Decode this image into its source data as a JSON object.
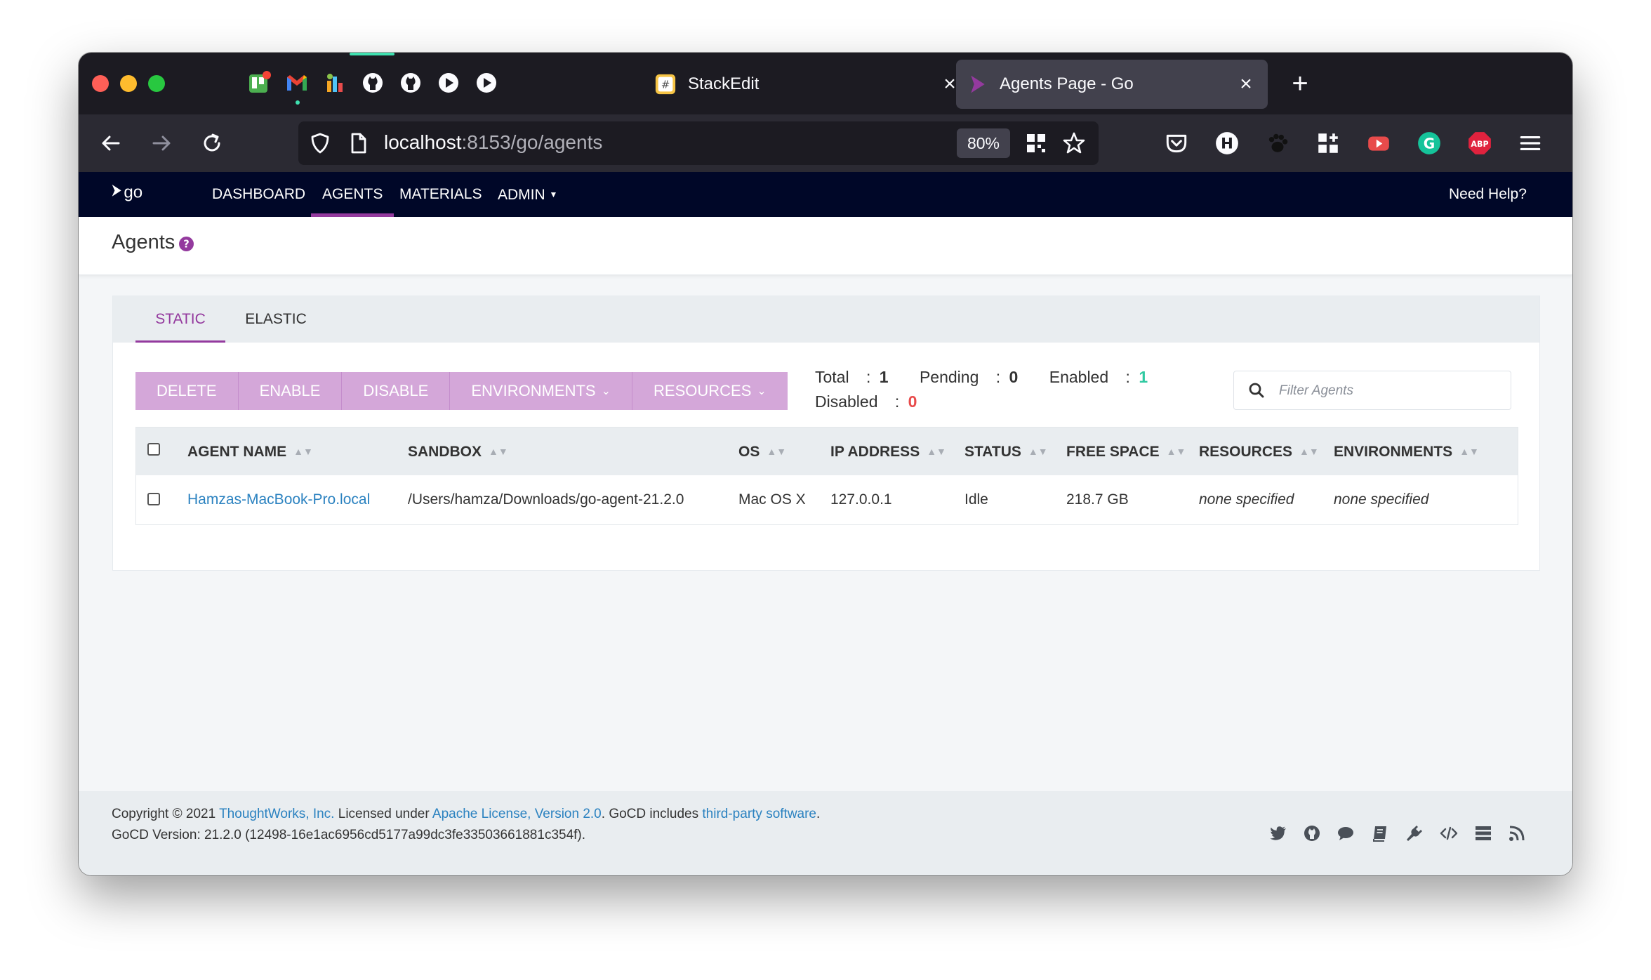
{
  "browser": {
    "tabs": [
      {
        "title": "StackEdit",
        "close": "×"
      },
      {
        "title": "Agents Page - Go",
        "close": "×"
      }
    ],
    "new_tab": "+",
    "url_host": "localhost",
    "url_path": ":8153/go/agents",
    "zoom": "80%"
  },
  "gocd_nav": {
    "links": [
      "DASHBOARD",
      "AGENTS",
      "MATERIALS",
      "ADMIN"
    ],
    "help": "Need Help?"
  },
  "page": {
    "title": "Agents"
  },
  "tabs": [
    "STATIC",
    "ELASTIC"
  ],
  "actions": {
    "delete": "DELETE",
    "enable": "ENABLE",
    "disable": "DISABLE",
    "environments": "ENVIRONMENTS",
    "resources": "RESOURCES"
  },
  "stats": {
    "total_label": "Total",
    "total": "1",
    "pending_label": "Pending",
    "pending": "0",
    "enabled_label": "Enabled",
    "enabled": "1",
    "disabled_label": "Disabled",
    "disabled": "0",
    "sep": ":"
  },
  "filter": {
    "placeholder": "Filter Agents"
  },
  "table": {
    "columns": [
      "AGENT NAME",
      "SANDBOX",
      "OS",
      "IP ADDRESS",
      "STATUS",
      "FREE SPACE",
      "RESOURCES",
      "ENVIRONMENTS"
    ],
    "rows": [
      {
        "agent_name": "Hamzas-MacBook-Pro.local",
        "sandbox": "/Users/hamza/Downloads/go-agent-21.2.0",
        "os": "Mac OS X",
        "ip": "127.0.0.1",
        "status": "Idle",
        "free_space": "218.7 GB",
        "resources": "none specified",
        "environments": "none specified"
      }
    ]
  },
  "footer": {
    "copyright": "Copyright © 2021 ",
    "company": "ThoughtWorks, Inc.",
    "licensed": " Licensed under ",
    "license": "Apache License, Version 2.0",
    "includes": ". GoCD includes ",
    "third_party": "third-party software",
    "dot": ".",
    "version": "GoCD Version: 21.2.0 (12498-16e1ac6956cd5177a99dc3fe33503661881c354f)."
  },
  "colors": {
    "accent": "#943a9e",
    "button": "#d4a7d9",
    "link": "#2b82c0",
    "enabled": "#2fc9a1",
    "disabled": "#e84b4b",
    "header": "#000728"
  }
}
